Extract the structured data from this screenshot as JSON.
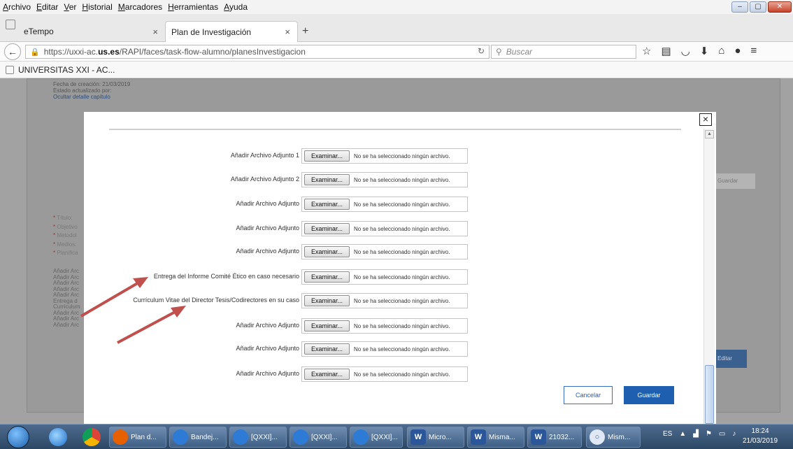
{
  "menu": [
    {
      "label": "Archivo",
      "u": 0
    },
    {
      "label": "Editar",
      "u": 0
    },
    {
      "label": "Ver",
      "u": 0
    },
    {
      "label": "Historial",
      "u": 0
    },
    {
      "label": "Marcadores",
      "u": 0
    },
    {
      "label": "Herramientas",
      "u": 0
    },
    {
      "label": "Ayuda",
      "u": 0
    }
  ],
  "tabs": {
    "tab1": "eTempo",
    "tab2": "Plan de Investigación",
    "close": "×",
    "new": "+"
  },
  "nav": {
    "url_prefix": "https://uxxi-ac.",
    "url_domain": "us.es",
    "url_path": "/RAPI/faces/task-flow-alumno/planesInvestigacion",
    "search_placeholder": "Buscar"
  },
  "bookmarks": {
    "item": "UNIVERSITAS XXI - AC..."
  },
  "background": {
    "fecha": "Fecha de creación:  21/03/2019",
    "estado": "Estado actualizado por:",
    "ocultar": "Ocultar detalle capítulo",
    "guardar": "Guardar",
    "editar": "Editar",
    "fields": [
      "Título:",
      "Objetivo",
      "Metodol",
      "Medios:",
      "Planifica"
    ],
    "list": [
      "Añadir Arc",
      "Añadir Arc",
      "Añadir Arc",
      "Añadir Arc",
      "Añadir Arc",
      "Entrega d",
      "Curriculum",
      "Añadir Arc",
      "Añadir Arc",
      "Añadir Arc"
    ]
  },
  "modal": {
    "close": "×",
    "browse_label": "Examinar...",
    "no_file": "No se ha seleccionado ningún archivo.",
    "rows": [
      "Añadir Archivo Adjunto 1",
      "Añadir Archivo Adjunto 2",
      "Añadir Archivo Adjunto",
      "Añadir Archivo Adjunto",
      "Añadir Archivo Adjunto",
      "Entrega del Informe Comité Ético en caso necesario",
      "Currículum Vitae del Director Tesis/Codirectores en su caso",
      "Añadir Archivo Adjunto",
      "Añadir Archivo Adjunto",
      "Añadir Archivo Adjunto"
    ],
    "cancel": "Cancelar",
    "save": "Guardar"
  },
  "taskbar": {
    "items": [
      "Plan d...",
      "Bandej...",
      "[QXXI]...",
      "[QXXI]...",
      "[QXXI]...",
      "Micro...",
      "Misma...",
      "21032...",
      "Mism..."
    ],
    "lang": "ES",
    "time": "18:24",
    "date": "21/03/2019"
  },
  "colors": {
    "accent": "#1f5fb0",
    "arrow": "#c0504d"
  }
}
